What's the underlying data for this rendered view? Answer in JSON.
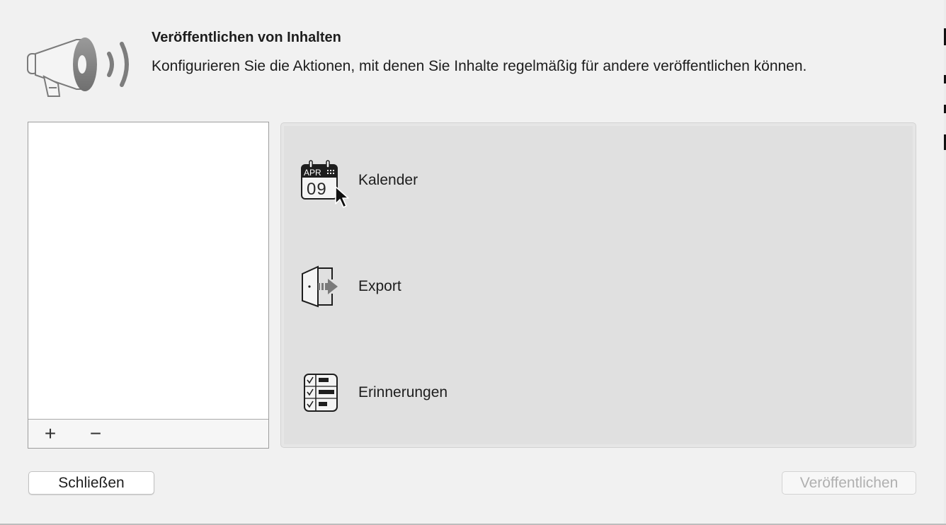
{
  "header": {
    "title": "Veröffentlichen von Inhalten",
    "subtitle": "Konfigurieren Sie die Aktionen, mit denen Sie Inhalte regelmäßig für andere veröffentlichen können.",
    "icon": "megaphone-icon"
  },
  "list": {
    "items": [],
    "add_label": "+",
    "remove_label": "−"
  },
  "actions": [
    {
      "label": "Kalender",
      "icon": "calendar-icon",
      "icon_month": "APR",
      "icon_day": "09"
    },
    {
      "label": "Export",
      "icon": "export-icon"
    },
    {
      "label": "Erinnerungen",
      "icon": "reminders-icon"
    }
  ],
  "buttons": {
    "close_label": "Schließen",
    "publish_label": "Veröffentlichen",
    "publish_enabled": false
  },
  "colors": {
    "window_bg": "#f1f1f1",
    "panel_bg": "#e0e0e0",
    "disabled_text": "#b0b0b0"
  }
}
